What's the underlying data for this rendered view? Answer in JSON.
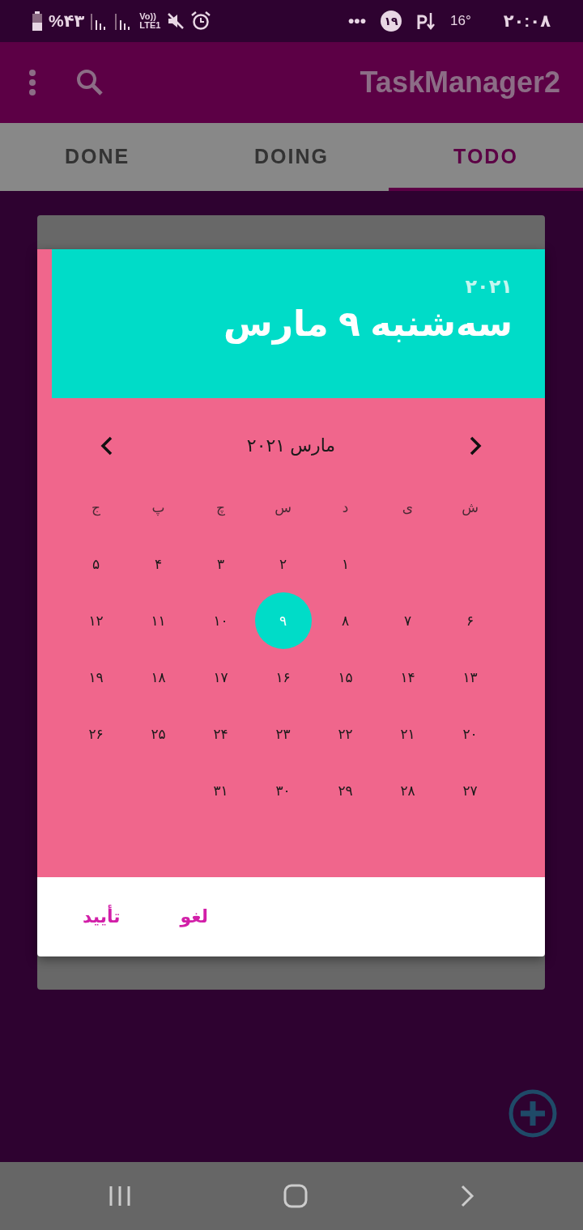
{
  "status_bar": {
    "battery": "%۴۳",
    "network_top": "Vo))",
    "network_bottom": "LTE1",
    "more": "•••",
    "notification_badge": "۱۹",
    "temperature": "16°",
    "time": "۲۰:۰۸"
  },
  "app_bar": {
    "title": "TaskManager2"
  },
  "tabs": [
    {
      "label": "TODO",
      "selected": true
    },
    {
      "label": "DOING",
      "selected": false
    },
    {
      "label": "DONE",
      "selected": false
    }
  ],
  "date_picker": {
    "year": "۲۰۲۱",
    "date": "سه‌شنبه ۹ مارس",
    "month": "مارس ۲۰۲۱",
    "weekdays": [
      "ش",
      "ی",
      "د",
      "س",
      "چ",
      "پ",
      "ج"
    ],
    "weeks": [
      [
        {
          "day": "۱",
          "selected": false
        },
        {
          "day": "۲",
          "selected": false
        },
        {
          "day": "۳",
          "selected": false
        },
        {
          "day": "۴",
          "selected": false
        },
        {
          "day": "۵",
          "selected": false
        }
      ],
      [
        {
          "day": "۶",
          "selected": false
        },
        {
          "day": "۷",
          "selected": false
        },
        {
          "day": "۸",
          "selected": false
        },
        {
          "day": "۹",
          "selected": true
        },
        {
          "day": "۱۰",
          "selected": false
        },
        {
          "day": "۱۱",
          "selected": false
        },
        {
          "day": "۱۲",
          "selected": false
        }
      ],
      [
        {
          "day": "۱۳",
          "selected": false
        },
        {
          "day": "۱۴",
          "selected": false
        },
        {
          "day": "۱۵",
          "selected": false
        },
        {
          "day": "۱۶",
          "selected": false
        },
        {
          "day": "۱۷",
          "selected": false
        },
        {
          "day": "۱۸",
          "selected": false
        },
        {
          "day": "۱۹",
          "selected": false
        }
      ],
      [
        {
          "day": "۲۰",
          "selected": false
        },
        {
          "day": "۲۱",
          "selected": false
        },
        {
          "day": "۲۲",
          "selected": false
        },
        {
          "day": "۲۳",
          "selected": false
        },
        {
          "day": "۲۴",
          "selected": false
        },
        {
          "day": "۲۵",
          "selected": false
        },
        {
          "day": "۲۶",
          "selected": false
        }
      ],
      [
        {
          "day": "۲۷",
          "selected": false
        },
        {
          "day": "۲۸",
          "selected": false
        },
        {
          "day": "۲۹",
          "selected": false
        },
        {
          "day": "۳۰",
          "selected": false
        },
        {
          "day": "۳۱",
          "selected": false
        }
      ]
    ],
    "buttons": [
      "لغو",
      "تأیید"
    ]
  }
}
